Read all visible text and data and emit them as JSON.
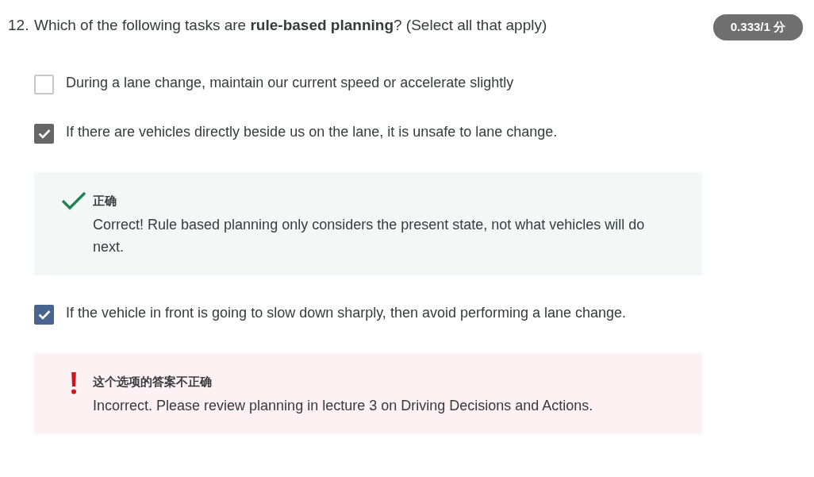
{
  "question": {
    "number": "12.",
    "text": "Which of the following tasks are **rule-based planning**? (Select all that apply)",
    "score": "0.333/1 分"
  },
  "items": [
    {
      "kind": "option",
      "text": "During a lane change, maintain our current speed or accelerate slightly",
      "checked": false,
      "color": "#c8c8c8"
    },
    {
      "kind": "option",
      "text": "If there are vehicles directly beside us on the lane, it is unsafe to lane change.",
      "checked": true,
      "color": "#666666"
    },
    {
      "kind": "correct",
      "title": "正确",
      "text": "Correct! Rule based planning only considers the present state, not what vehicles will do next."
    },
    {
      "kind": "option",
      "text": "If the vehicle in front is going to slow down sharply, then avoid performing a lane change.",
      "checked": true,
      "color": "#48658e"
    },
    {
      "kind": "incorrect",
      "title": "这个选项的答案不正确",
      "text": "Incorrect. Please review planning in lecture 3 on Driving Decisions and Actions."
    }
  ]
}
